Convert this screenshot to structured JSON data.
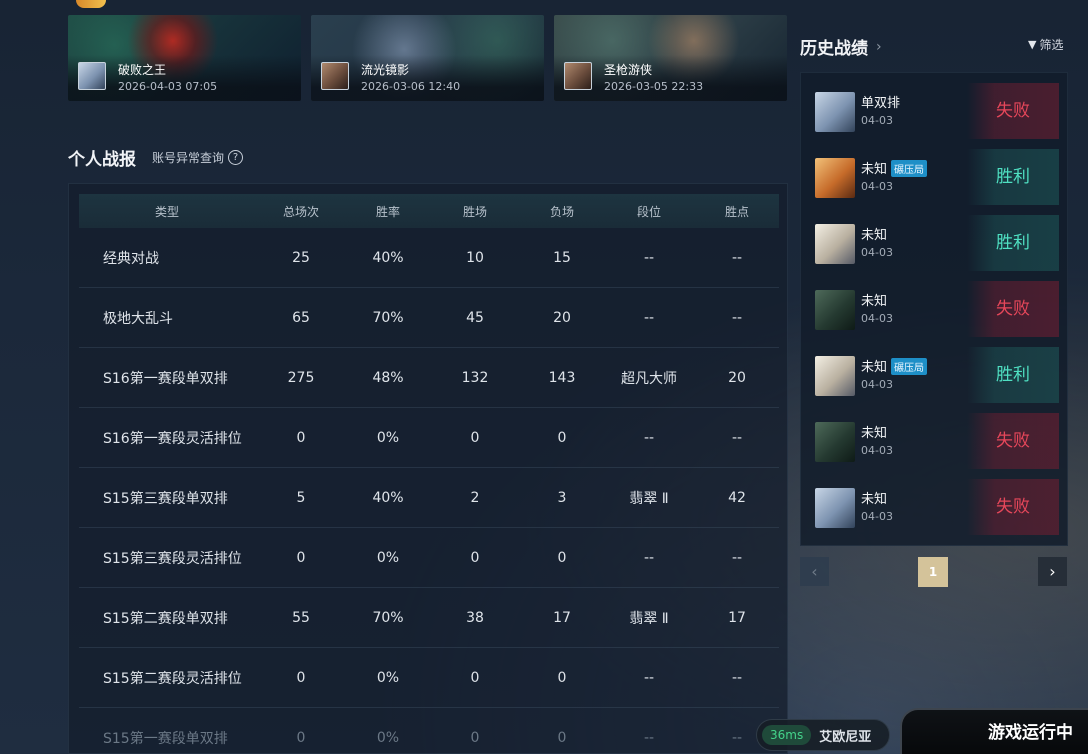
{
  "recent_matches": [
    {
      "champion": "破败之王",
      "time": "2026-04-03 07:05"
    },
    {
      "champion": "流光镜影",
      "time": "2026-03-06 12:40"
    },
    {
      "champion": "圣枪游侠",
      "time": "2026-03-05 22:33"
    }
  ],
  "stats": {
    "title": "个人战报",
    "link": "账号异常查询",
    "help_icon": "?",
    "headers": {
      "type": "类型",
      "total": "总场次",
      "rate": "胜率",
      "wins": "胜场",
      "losses": "负场",
      "tier": "段位",
      "lp": "胜点"
    },
    "rows": [
      {
        "type": "经典对战",
        "total": "25",
        "rate": "40%",
        "wins": "10",
        "losses": "15",
        "tier": "--",
        "lp": "--"
      },
      {
        "type": "极地大乱斗",
        "total": "65",
        "rate": "70%",
        "wins": "45",
        "losses": "20",
        "tier": "--",
        "lp": "--"
      },
      {
        "type": "S16第一赛段单双排",
        "total": "275",
        "rate": "48%",
        "wins": "132",
        "losses": "143",
        "tier": "超凡大师",
        "lp": "20"
      },
      {
        "type": "S16第一赛段灵活排位",
        "total": "0",
        "rate": "0%",
        "wins": "0",
        "losses": "0",
        "tier": "--",
        "lp": "--"
      },
      {
        "type": "S15第三赛段单双排",
        "total": "5",
        "rate": "40%",
        "wins": "2",
        "losses": "3",
        "tier": "翡翠 Ⅱ",
        "lp": "42"
      },
      {
        "type": "S15第三赛段灵活排位",
        "total": "0",
        "rate": "0%",
        "wins": "0",
        "losses": "0",
        "tier": "--",
        "lp": "--"
      },
      {
        "type": "S15第二赛段单双排",
        "total": "55",
        "rate": "70%",
        "wins": "38",
        "losses": "17",
        "tier": "翡翠 Ⅱ",
        "lp": "17"
      },
      {
        "type": "S15第二赛段灵活排位",
        "total": "0",
        "rate": "0%",
        "wins": "0",
        "losses": "0",
        "tier": "--",
        "lp": "--"
      },
      {
        "type": "S15第一赛段单双排",
        "total": "0",
        "rate": "0%",
        "wins": "0",
        "losses": "0",
        "tier": "--",
        "lp": "--"
      }
    ]
  },
  "history": {
    "title": "历史战绩",
    "title_chevron": "›",
    "filter_icon": "▼",
    "filter_label": "筛选",
    "items": [
      {
        "mode": "单双排",
        "tag": "",
        "date": "04-03",
        "result": "失败",
        "outcome": "lose"
      },
      {
        "mode": "未知",
        "tag": "碾压局",
        "date": "04-03",
        "result": "胜利",
        "outcome": "win"
      },
      {
        "mode": "未知",
        "tag": "",
        "date": "04-03",
        "result": "胜利",
        "outcome": "win"
      },
      {
        "mode": "未知",
        "tag": "",
        "date": "04-03",
        "result": "失败",
        "outcome": "lose"
      },
      {
        "mode": "未知",
        "tag": "碾压局",
        "date": "04-03",
        "result": "胜利",
        "outcome": "win"
      },
      {
        "mode": "未知",
        "tag": "",
        "date": "04-03",
        "result": "失败",
        "outcome": "lose"
      },
      {
        "mode": "未知",
        "tag": "",
        "date": "04-03",
        "result": "失败",
        "outcome": "lose"
      }
    ],
    "pager": {
      "prev": "‹",
      "page": "1",
      "next": "›"
    }
  },
  "footer": {
    "ping": "36ms",
    "server": "艾欧尼亚",
    "game_status": "游戏运行中"
  },
  "colors": {
    "win": "#4fe0c2",
    "lose": "#e6475a",
    "tag": "#1e8fc7",
    "page_active": "#d4c39a",
    "ping": "#44d48b"
  }
}
